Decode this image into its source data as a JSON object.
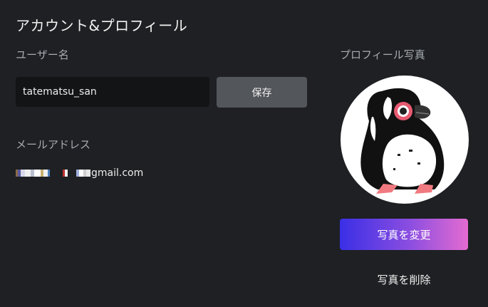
{
  "panel": {
    "title": "アカウント&プロフィール"
  },
  "username": {
    "label": "ユーザー名",
    "value": "tatematsu_san",
    "save_label": "保存"
  },
  "email": {
    "label": "メールアドレス",
    "visible_domain": "gmail.com"
  },
  "photo": {
    "label": "プロフィール写真",
    "avatar_icon": "penguin-avatar-icon",
    "change_label": "写真を変更",
    "delete_label": "写真を削除"
  },
  "colors": {
    "background": "#1e2023",
    "input_background": "#131416",
    "save_button": "#53565b",
    "change_button_gradient_start": "#3a2fe6",
    "change_button_gradient_end": "#e46bd1"
  }
}
